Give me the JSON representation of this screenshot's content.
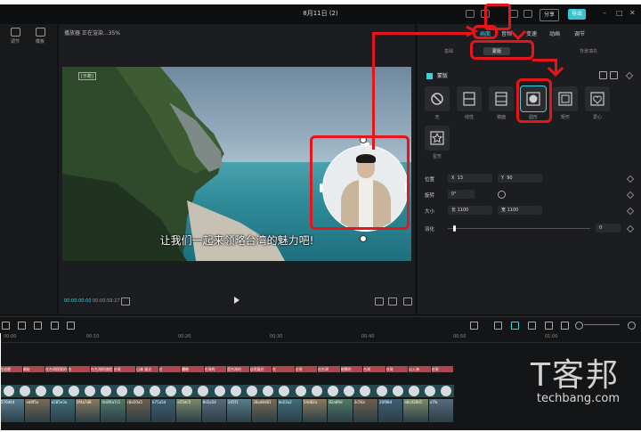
{
  "app": {
    "title": "8月11日 (2)",
    "export_label": "导出",
    "share_label": "分享"
  },
  "left_panel": {
    "items": [
      {
        "label": "调节"
      },
      {
        "label": "模板"
      }
    ]
  },
  "player": {
    "header": "播放器 正在渲染...35%",
    "video_label": "[示範]",
    "subtitle": "让我们一起来领略台湾的魅力吧!",
    "time_current": "00:00:00:00",
    "time_total": "00:00:59:27"
  },
  "inspector": {
    "tabs": [
      "画面",
      "音频",
      "变速",
      "动画",
      "调节"
    ],
    "active_tab": "画面",
    "subtabs": [
      "基础",
      "蒙版",
      "背景填充"
    ],
    "active_subtab": "蒙版",
    "section_label": "蒙版",
    "masks": [
      {
        "name": "无",
        "icon": "none-icon"
      },
      {
        "name": "线性",
        "icon": "linear-icon"
      },
      {
        "name": "镜面",
        "icon": "mirror-icon"
      },
      {
        "name": "圆形",
        "icon": "circle-icon"
      },
      {
        "name": "矩形",
        "icon": "rectangle-icon"
      },
      {
        "name": "爱心",
        "icon": "heart-icon"
      },
      {
        "name": "星形",
        "icon": "star-icon"
      }
    ],
    "selected_mask": "圆形",
    "position_label": "位置",
    "position_x": "13",
    "position_y": "90",
    "rotation_label": "旋转",
    "rotation_value": "0°",
    "size_label": "大小",
    "size_w": "1100",
    "size_h": "1100",
    "feather_label": "羽化",
    "feather_value": "0"
  },
  "timeline": {
    "ruler": [
      "00:00",
      "00:10",
      "00:20",
      "00:30",
      "00:40",
      "00:50",
      "01:00"
    ],
    "text_clips": [
      "在這裡",
      "開始",
      "在台灣探索的",
      "台",
      "在台灣的旅程",
      "台灣",
      "山林 風光",
      "在",
      "體驗",
      "台灣的",
      "是台灣的",
      "自然風光",
      "在",
      "台灣",
      "在台灣",
      "熱鬧的",
      "台灣",
      "台灣",
      "以入海",
      "台灣"
    ],
    "video_clips": [
      "576d4d",
      "ad8f5e",
      "a585e3a",
      "0f4a7d8",
      "0c8f4a7c1",
      "c8a50a5",
      "b75a5d",
      "e15dc5",
      "8d1a54",
      "245f1",
      "28ad8d81",
      "4e22a2",
      "54d82a",
      "82a89d",
      "3c56a",
      "20f88d",
      "a6cd28d1",
      "a7fa"
    ]
  },
  "watermark": {
    "logo": "T客邦",
    "site": "techbang.com"
  },
  "colors": {
    "accent": "#39d3e0",
    "annotation": "#e4161b"
  }
}
